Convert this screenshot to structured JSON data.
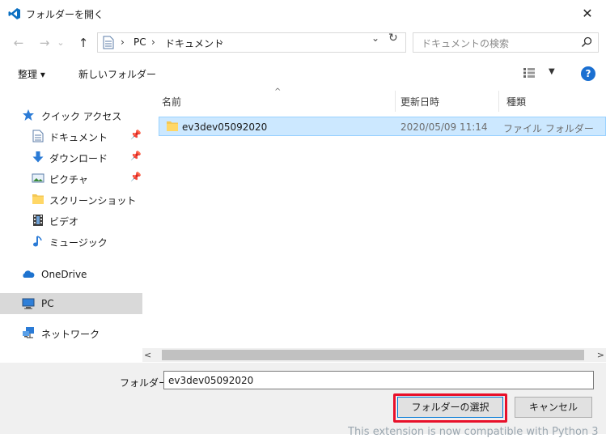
{
  "window": {
    "title": "フォルダーを開く",
    "close_glyph": "✕"
  },
  "address": {
    "back": "←",
    "forward": "→",
    "recent": "⌄",
    "up": "↑",
    "sep1": "›",
    "seg_pc": "PC",
    "sep2": "›",
    "seg_docs": "ドキュメント",
    "sep3": "›",
    "dropdown": "⌄",
    "refresh": "↻",
    "search_placeholder": "ドキュメントの検索"
  },
  "commands": {
    "organize": "整理 ▾",
    "new_folder": "新しいフォルダー",
    "view_drop": "▼",
    "help": "?"
  },
  "sidebar": {
    "items": [
      {
        "label": "クイック アクセス",
        "icon": "star-icon"
      },
      {
        "label": "ドキュメント",
        "icon": "document-icon",
        "pinned": true
      },
      {
        "label": "ダウンロード",
        "icon": "download-icon",
        "pinned": true
      },
      {
        "label": "ピクチャ",
        "icon": "picture-icon",
        "pinned": true
      },
      {
        "label": "スクリーンショット",
        "icon": "folder-icon"
      },
      {
        "label": "ビデオ",
        "icon": "video-icon"
      },
      {
        "label": "ミュージック",
        "icon": "music-icon"
      },
      {
        "label": "OneDrive",
        "icon": "cloud-icon"
      },
      {
        "label": "PC",
        "icon": "computer-icon"
      },
      {
        "label": "ネットワーク",
        "icon": "network-icon"
      }
    ],
    "pin_glyph": "📌"
  },
  "columns": {
    "name": "名前",
    "modified": "更新日時",
    "type": "種類",
    "sort_glyph": "^"
  },
  "files": [
    {
      "name": "ev3dev05092020",
      "modified": "2020/05/09 11:14",
      "type": "ファイル フォルダー",
      "selected": true
    }
  ],
  "scrollbar": {
    "left": "<",
    "right": ">"
  },
  "footer": {
    "folder_label": "フォルダー:",
    "folder_value": "ev3dev05092020",
    "select_button": "フォルダーの選択",
    "cancel_button": "キャンセル",
    "background_text": "This extension is now compatible with Python 3"
  },
  "colors": {
    "accent": "#0078d7",
    "selection": "#cce8ff",
    "highlight_box": "#e8102a"
  }
}
